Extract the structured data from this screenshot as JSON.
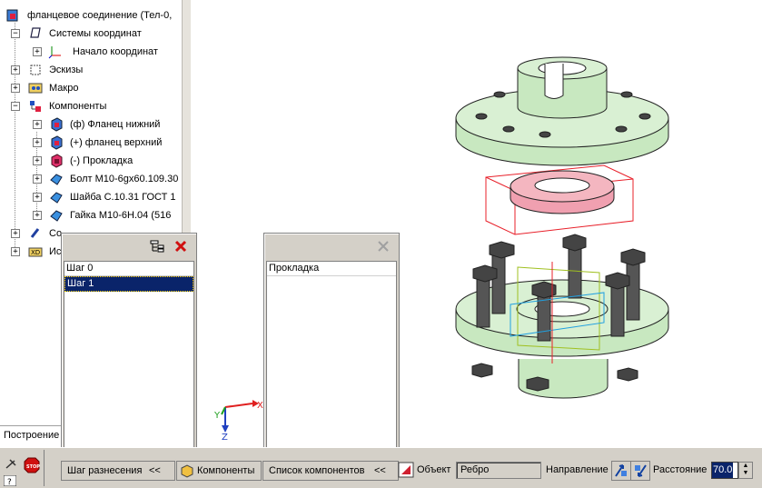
{
  "tree": {
    "items": [
      {
        "label": "фланцевое соединение (Тел-0,",
        "icon": "assembly-icon"
      },
      {
        "label": "Системы координат",
        "icon": "coordinate-systems-icon"
      },
      {
        "label": "Начало координат",
        "icon": "origin-icon"
      },
      {
        "label": "Эскизы",
        "icon": "sketches-icon"
      },
      {
        "label": "Макро",
        "icon": "macro-icon"
      },
      {
        "label": "Компоненты",
        "icon": "components-icon"
      },
      {
        "label": "(ф) Фланец нижний",
        "icon": "part-icon"
      },
      {
        "label": "(+) фланец верхний",
        "icon": "part-icon"
      },
      {
        "label": "(-) Прокладка",
        "icon": "part-icon"
      },
      {
        "label": "Болт М10-6gx60.109.30",
        "icon": "standard-part-icon"
      },
      {
        "label": "Шайба С.10.31 ГОСТ 1",
        "icon": "standard-part-icon"
      },
      {
        "label": "Гайка  М10-6Н.04 (516",
        "icon": "standard-part-icon"
      },
      {
        "label": "Со",
        "icon": "connections-icon"
      },
      {
        "label": "Ис",
        "icon": "variables-icon"
      }
    ],
    "status": "Построение"
  },
  "steps_panel": {
    "items": [
      "Шаг 0",
      "Шаг 1"
    ],
    "selected": 1,
    "tab_label": "Шаг разнесения",
    "tab_chevron": "<<"
  },
  "components_panel": {
    "items": [
      "Прокладка"
    ],
    "tab_label": "Список компонентов",
    "tab_chevron": "<<"
  },
  "bottom": {
    "components_button": "Компоненты",
    "object_label": "Объект",
    "object_value": "Ребро",
    "direction_label": "Направление",
    "distance_label": "Расстояние",
    "distance_value": "70.0"
  },
  "axes": {
    "x": "X",
    "y": "Y",
    "z": "Z"
  },
  "colors": {
    "part_green": "#d9f0d3",
    "gasket_pink": "#f4b6c0",
    "selection_red": "#e8202a",
    "selection_bg": "#0a246a"
  }
}
